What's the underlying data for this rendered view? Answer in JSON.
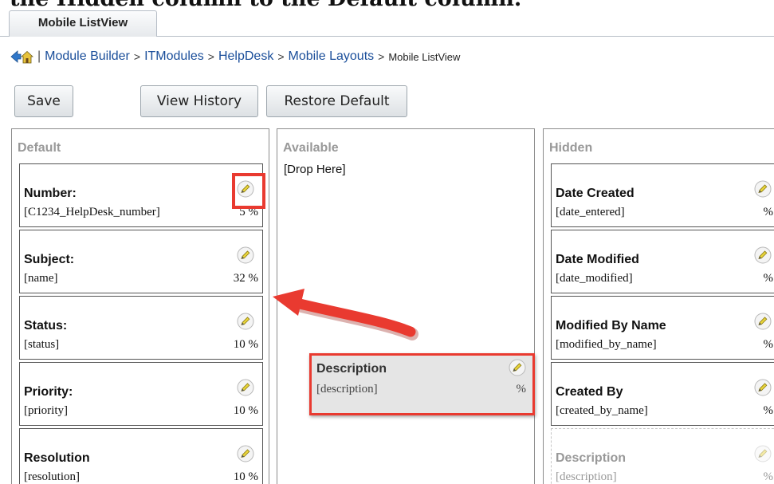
{
  "heading_partial": "the Hidden column to the Default column.",
  "tab": {
    "label": "Mobile ListView"
  },
  "breadcrumb": {
    "separator": "|",
    "arrow": ">",
    "links": [
      "Module Builder",
      "ITModules",
      "HelpDesk",
      "Mobile Layouts"
    ],
    "current": "Mobile ListView"
  },
  "toolbar": {
    "save": "Save",
    "view_history": "View History",
    "restore_default": "Restore Default"
  },
  "columns": {
    "default": {
      "title": "Default",
      "items": [
        {
          "label": "Number:",
          "field": "[C1234_HelpDesk_number]",
          "pct": "5 %"
        },
        {
          "label": "Subject:",
          "field": "[name]",
          "pct": "32 %"
        },
        {
          "label": "Status:",
          "field": "[status]",
          "pct": "10 %"
        },
        {
          "label": "Priority:",
          "field": "[priority]",
          "pct": "10 %"
        },
        {
          "label": "Resolution",
          "field": "[resolution]",
          "pct": "10 %"
        }
      ]
    },
    "available": {
      "title": "Available",
      "drop_hint": "[Drop Here]"
    },
    "hidden": {
      "title": "Hidden",
      "items": [
        {
          "label": "Date Created",
          "field": "[date_entered]",
          "pct": "%"
        },
        {
          "label": "Date Modified",
          "field": "[date_modified]",
          "pct": "%"
        },
        {
          "label": "Modified By Name",
          "field": "[modified_by_name]",
          "pct": "%"
        },
        {
          "label": "Created By",
          "field": "[created_by_name]",
          "pct": "%"
        },
        {
          "label": "Description",
          "field": "[description]",
          "pct": "%"
        }
      ]
    }
  },
  "dragged_item": {
    "label": "Description",
    "field": "[description]",
    "pct": "%"
  },
  "colors": {
    "annotation_red": "#e93a30",
    "link_blue": "#1a4e9a",
    "panel_title_gray": "#999999"
  }
}
